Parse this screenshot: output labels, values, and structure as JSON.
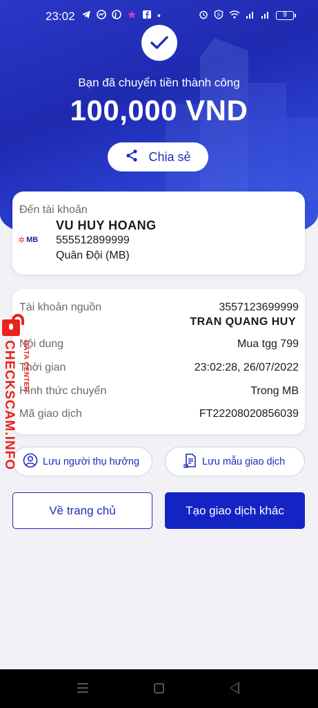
{
  "status_bar": {
    "time": "23:02",
    "left_icons": [
      "telegram-icon",
      "messenger-icon",
      "pinterest-icon",
      "app-icon",
      "facebook-icon",
      "dot-icon"
    ],
    "right_icons": [
      "alarm-icon",
      "vpn-icon",
      "wifi-icon",
      "signal-icon",
      "signal-icon"
    ],
    "battery": "9"
  },
  "hero": {
    "subtitle": "Bạn đã chuyển tiền thành công",
    "amount": "100,000 VND",
    "share_label": "Chia sẻ"
  },
  "recipient": {
    "to_label": "Đến tài khoản",
    "bank_logo": "MB",
    "name": "VU HUY HOANG",
    "account": "555512899999",
    "bank": "Quân Đội (MB)"
  },
  "details": {
    "source_label": "Tài khoản nguồn",
    "source_account": "3557123699999",
    "source_name": "TRAN QUANG HUY",
    "content_label": "Nội dung",
    "content_value": "Mua tgg 799",
    "time_label": "Thời gian",
    "time_value": "23:02:28, 26/07/2022",
    "method_label": "Hình thức chuyển",
    "method_value": "Trong MB",
    "txn_label": "Mã giao dịch",
    "txn_value": "FT22208020856039"
  },
  "actions": {
    "save_beneficiary": "Lưu người thụ hưởng",
    "save_template": "Lưu mẫu giao dịch",
    "home": "Về trang chủ",
    "new_transaction": "Tạo giao dịch khác"
  },
  "watermark": {
    "main": "CHECKSCAM.INFO",
    "sub": "DATA CENTER"
  },
  "colors": {
    "brand_blue": "#1f2bb8",
    "primary_button": "#1424c4",
    "watermark_red": "#e8231c"
  }
}
